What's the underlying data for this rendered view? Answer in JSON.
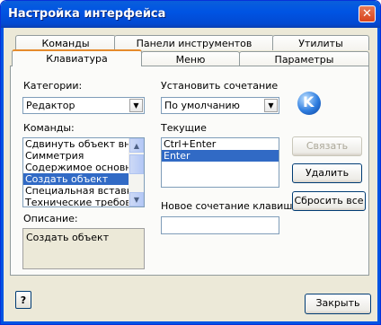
{
  "window": {
    "title": "Настройка интерфейса"
  },
  "tabs": {
    "row1": [
      "Команды",
      "Панели инструментов",
      "Утилиты"
    ],
    "row2": [
      "Клавиатура",
      "Меню",
      "Параметры"
    ],
    "active": "Клавиатура"
  },
  "categories": {
    "label": "Категории:",
    "value": "Редактор"
  },
  "commands": {
    "label": "Команды:",
    "items": [
      "Сдвинуть объект вниз",
      "Симметрия",
      "Содержимое основной",
      "Создать объект",
      "Специальная вставка...",
      "Технические требования"
    ],
    "selected": "Создать объект"
  },
  "description": {
    "label": "Описание:",
    "text": "Создать объект"
  },
  "set_shortcut": {
    "label": "Установить сочетание",
    "value": "По умолчанию"
  },
  "current": {
    "label": "Текущие",
    "items": [
      "Ctrl+Enter",
      "Enter"
    ],
    "selected": "Enter"
  },
  "new_shortcut": {
    "label": "Новое сочетание клавиш:",
    "value": ""
  },
  "buttons": {
    "assign": "Связать",
    "delete": "Удалить",
    "reset_all": "Сбросить все",
    "close": "Закрыть",
    "help": "?"
  },
  "logo": {
    "letter": "K"
  },
  "colors": {
    "title_bar": "#0054e3",
    "selection": "#316ac5",
    "face": "#ece9d8",
    "close_button": "#d8441c"
  }
}
